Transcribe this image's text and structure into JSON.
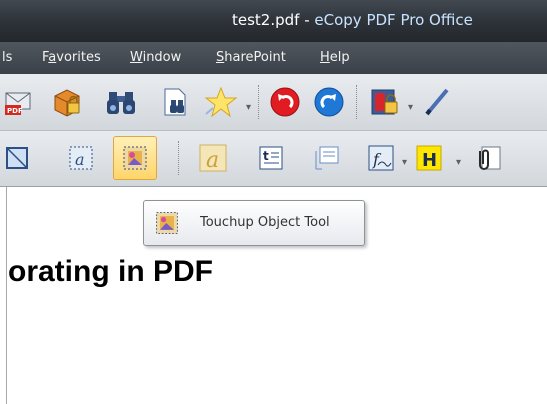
{
  "window": {
    "title_file": "test2.pdf",
    "title_sep": " - ",
    "title_app": "eCopy PDF Pro Office"
  },
  "menubar": {
    "items": [
      {
        "label": "ls"
      },
      {
        "label": "Favorites"
      },
      {
        "label": "Window"
      },
      {
        "label": "SharePoint"
      },
      {
        "label": "Help"
      }
    ]
  },
  "toolbar_row1": {
    "icons": [
      "email-pdf-icon",
      "lock-package-icon",
      "binoculars-icon",
      "document-search-icon",
      "star-icon",
      "undo-icon",
      "redo-icon",
      "security-icon",
      "pen-icon"
    ]
  },
  "toolbar_row2": {
    "icons": [
      "crop-icon",
      "select-text-icon",
      "touchup-object-icon",
      "typewriter-icon",
      "text-box-icon",
      "note-icon",
      "signature-icon",
      "highlight-icon",
      "attach-icon"
    ],
    "active": "touchup-object-icon"
  },
  "tooltip": {
    "label": "Touchup Object Tool"
  },
  "document": {
    "heading": "orating in PDF"
  },
  "colors": {
    "title_bar": "#2d3238",
    "app_name": "#c8e2ff",
    "active_tool": "#ffd56a"
  }
}
